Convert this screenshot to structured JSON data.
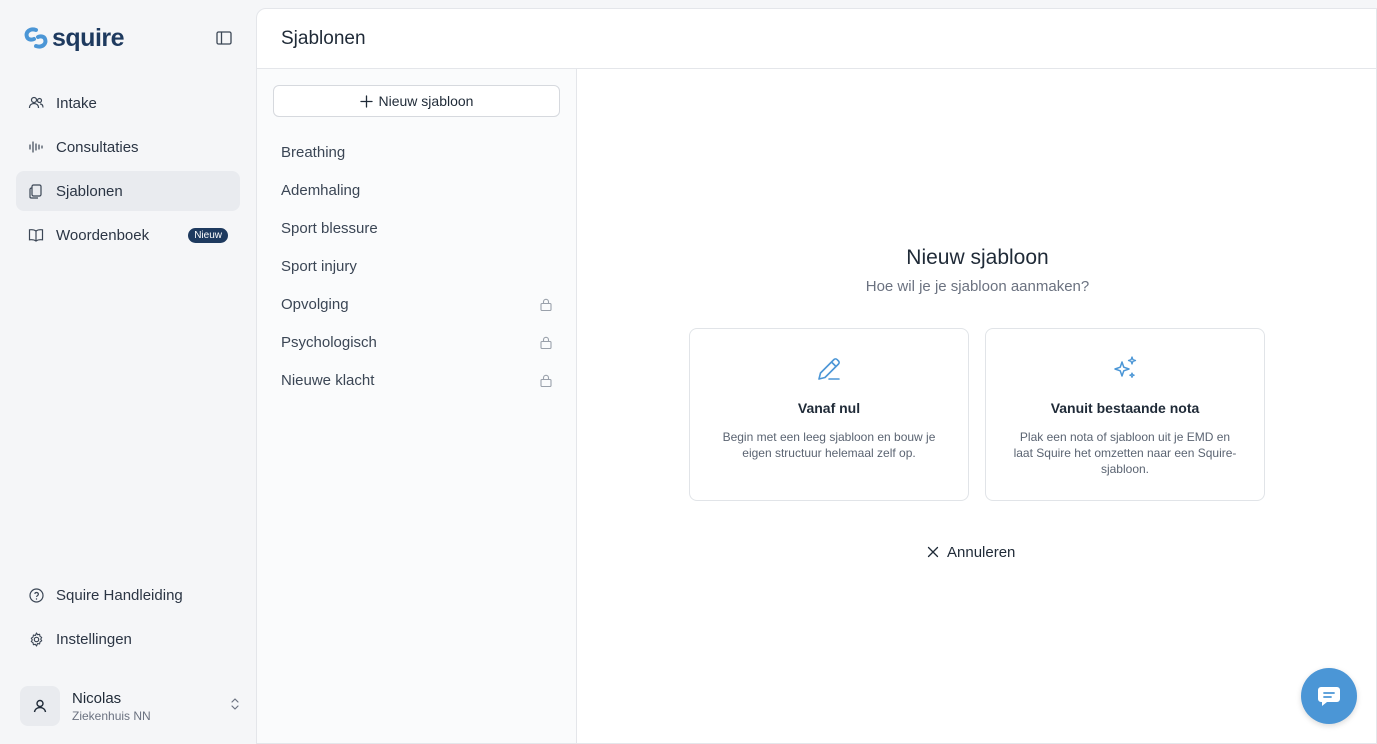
{
  "brand": {
    "name": "squire",
    "accent": "#4b96d6",
    "dark": "#1e3a5f"
  },
  "sidebar": {
    "items": [
      {
        "label": "Intake",
        "icon": "users-icon"
      },
      {
        "label": "Consultaties",
        "icon": "waveform-icon"
      },
      {
        "label": "Sjablonen",
        "icon": "document-copy-icon",
        "active": true
      },
      {
        "label": "Woordenboek",
        "icon": "book-icon",
        "badge": "Nieuw"
      }
    ],
    "bottom_items": [
      {
        "label": "Squire Handleiding",
        "icon": "help-circle-icon"
      },
      {
        "label": "Instellingen",
        "icon": "gear-icon"
      }
    ],
    "user": {
      "name": "Nicolas",
      "org": "Ziekenhuis NN"
    }
  },
  "header": {
    "title": "Sjablonen"
  },
  "templates": {
    "new_button": "Nieuw sjabloon",
    "items": [
      {
        "label": "Breathing",
        "locked": false
      },
      {
        "label": "Ademhaling",
        "locked": false
      },
      {
        "label": "Sport blessure",
        "locked": false
      },
      {
        "label": "Sport injury",
        "locked": false
      },
      {
        "label": "Opvolging",
        "locked": true
      },
      {
        "label": "Psychologisch",
        "locked": true
      },
      {
        "label": "Nieuwe klacht",
        "locked": true
      }
    ]
  },
  "creator": {
    "title": "Nieuw sjabloon",
    "subtitle": "Hoe wil je je sjabloon aanmaken?",
    "options": [
      {
        "title": "Vanaf nul",
        "description": "Begin met een leeg sjabloon en bouw je eigen structuur helemaal zelf op.",
        "icon": "pencil-icon"
      },
      {
        "title": "Vanuit bestaande nota",
        "description": "Plak een nota of sjabloon uit je EMD en laat Squire het omzetten naar een Squire-sjabloon.",
        "icon": "sparkles-icon"
      }
    ],
    "cancel": "Annuleren"
  }
}
